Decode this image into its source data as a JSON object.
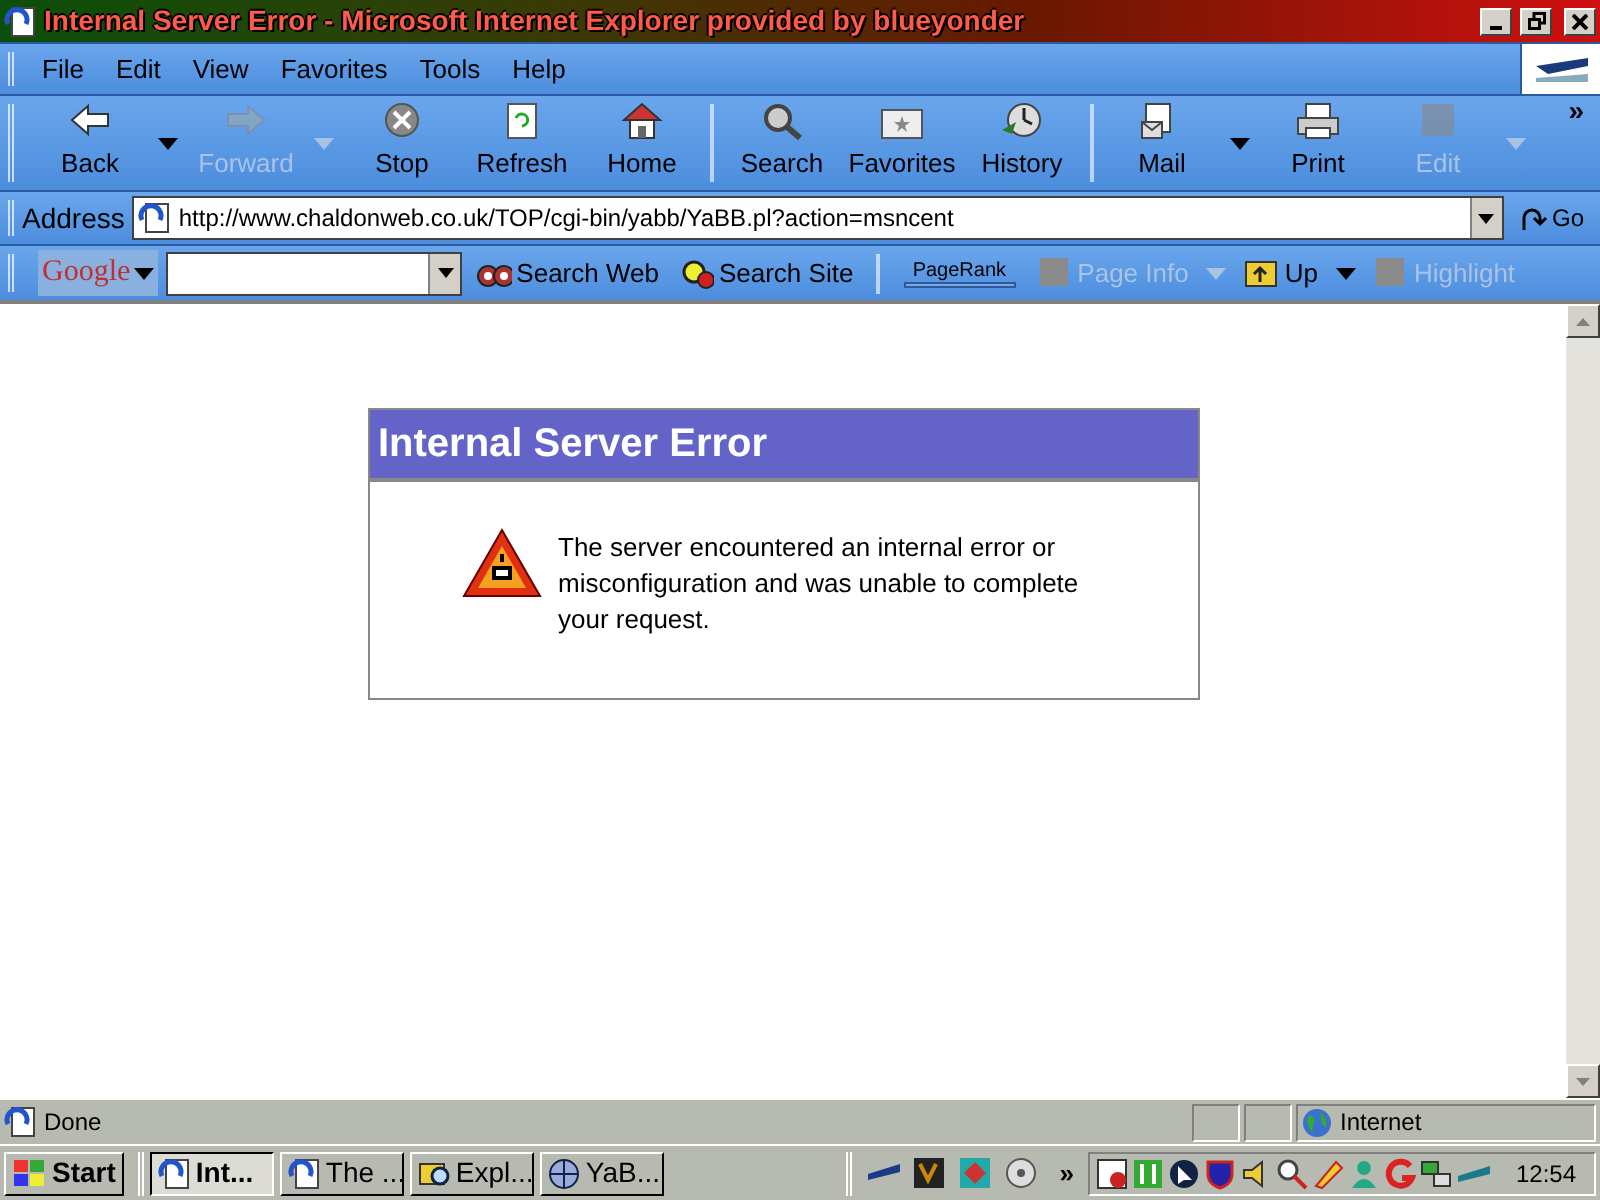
{
  "window": {
    "title": "Internal Server Error - Microsoft Internet Explorer provided by blueyonder"
  },
  "menu": [
    "File",
    "Edit",
    "View",
    "Favorites",
    "Tools",
    "Help"
  ],
  "toolbar": [
    {
      "kind": "back",
      "label": "Back",
      "disabled": false,
      "dropdown": true
    },
    {
      "kind": "forward",
      "label": "Forward",
      "disabled": true,
      "dropdown": true
    },
    {
      "kind": "stop",
      "label": "Stop",
      "disabled": false,
      "dropdown": false
    },
    {
      "kind": "refresh",
      "label": "Refresh",
      "disabled": false,
      "dropdown": false
    },
    {
      "kind": "home",
      "label": "Home",
      "disabled": false,
      "dropdown": false,
      "separator_after": true
    },
    {
      "kind": "search",
      "label": "Search",
      "disabled": false,
      "dropdown": false
    },
    {
      "kind": "favorites",
      "label": "Favorites",
      "disabled": false,
      "dropdown": false
    },
    {
      "kind": "history",
      "label": "History",
      "disabled": false,
      "dropdown": false,
      "separator_after": true
    },
    {
      "kind": "mail",
      "label": "Mail",
      "disabled": false,
      "dropdown": true
    },
    {
      "kind": "print",
      "label": "Print",
      "disabled": false,
      "dropdown": false
    },
    {
      "kind": "edit",
      "label": "Edit",
      "disabled": true,
      "dropdown": true
    }
  ],
  "toolbar_more": "»",
  "address": {
    "label": "Address",
    "url": "http://www.chaldonweb.co.uk/TOP/cgi-bin/yabb/YaBB.pl?action=msncent",
    "go": "Go"
  },
  "google_bar": {
    "logo": "Google",
    "items": [
      {
        "kind": "searchweb",
        "label": "Search Web",
        "disabled": false,
        "dropdown": false
      },
      {
        "kind": "searchsite",
        "label": "Search Site",
        "disabled": false,
        "dropdown": false
      },
      {
        "kind": "pagerank",
        "label": "PageRank"
      },
      {
        "kind": "pageinfo",
        "label": "Page Info",
        "disabled": true,
        "dropdown": true
      },
      {
        "kind": "up",
        "label": "Up",
        "disabled": false,
        "dropdown": true
      },
      {
        "kind": "highlight",
        "label": "Highlight",
        "disabled": true,
        "dropdown": false
      }
    ]
  },
  "page": {
    "heading": "Internal Server Error",
    "message": "The server encountered an internal error or misconfiguration and was unable to complete your request."
  },
  "status_bar": {
    "text": "Done",
    "zone": "Internet"
  },
  "taskbar": {
    "start": "Start",
    "tasks": [
      {
        "kind": "ie",
        "label": "Int...",
        "selected": true
      },
      {
        "kind": "ie",
        "label": "The ...",
        "selected": false
      },
      {
        "kind": "explorer",
        "label": "Expl...",
        "selected": false
      },
      {
        "kind": "yabb",
        "label": "YaB...",
        "selected": false
      }
    ],
    "more": "»",
    "clock": "12:54"
  }
}
